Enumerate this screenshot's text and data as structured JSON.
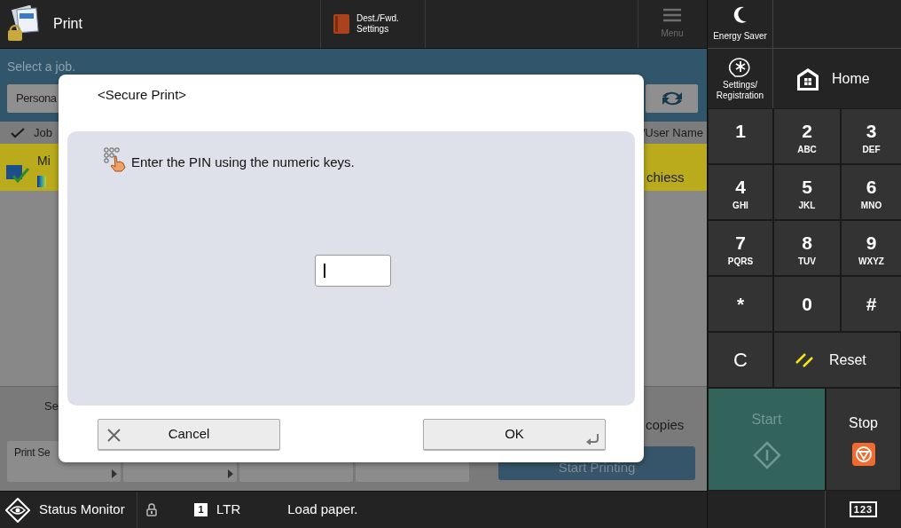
{
  "header": {
    "app_title": "Print",
    "dest_button": [
      "Dest./Fwd.",
      "Settings"
    ],
    "menu_button": {
      "label": "Menu",
      "disabled": true
    }
  },
  "job_screen": {
    "prompt": "Select a job.",
    "filter_button": "Persona",
    "columns": [
      "Job",
      "/User Name"
    ],
    "rows": [
      {
        "name": "Mi",
        "user": "chiess",
        "selected": true
      }
    ],
    "settings_label": "Se",
    "option_buttons": [
      {
        "label": "Print Se",
        "arrow": true
      },
      {
        "arrow": true
      },
      {
        "arrow": false
      },
      {
        "arrow": false
      }
    ],
    "copies_label": "copies",
    "start_printing_button": "Start Printing"
  },
  "dialog": {
    "title": "<Secure Print>",
    "message": "Enter the PIN using the numeric keys.",
    "buttons": [
      {
        "kind": "cancel",
        "label": "Cancel"
      },
      {
        "kind": "ok",
        "label": "OK"
      }
    ]
  },
  "side_panel": {
    "energy_saver": "Energy Saver",
    "settings": [
      "Settings/",
      "Registration"
    ],
    "home": "Home",
    "keys": [
      {
        "main": "1"
      },
      {
        "main": "2",
        "sub": "ABC"
      },
      {
        "main": "3",
        "sub": "DEF"
      },
      {
        "main": "4",
        "sub": "GHI"
      },
      {
        "main": "5",
        "sub": "JKL"
      },
      {
        "main": "6",
        "sub": "MNO"
      },
      {
        "main": "7",
        "sub": "PQRS"
      },
      {
        "main": "8",
        "sub": "TUV"
      },
      {
        "main": "9",
        "sub": "WXYZ"
      },
      {
        "main": "*"
      },
      {
        "main": "0"
      },
      {
        "main": "#"
      }
    ],
    "clear": "C",
    "reset": "Reset",
    "start": {
      "label": "Start",
      "disabled": true
    },
    "stop": "Stop",
    "input_mode": "123"
  },
  "status_bar": {
    "status_monitor": "Status Monitor",
    "tray": "1",
    "paper": "LTR",
    "message": "Load paper."
  }
}
